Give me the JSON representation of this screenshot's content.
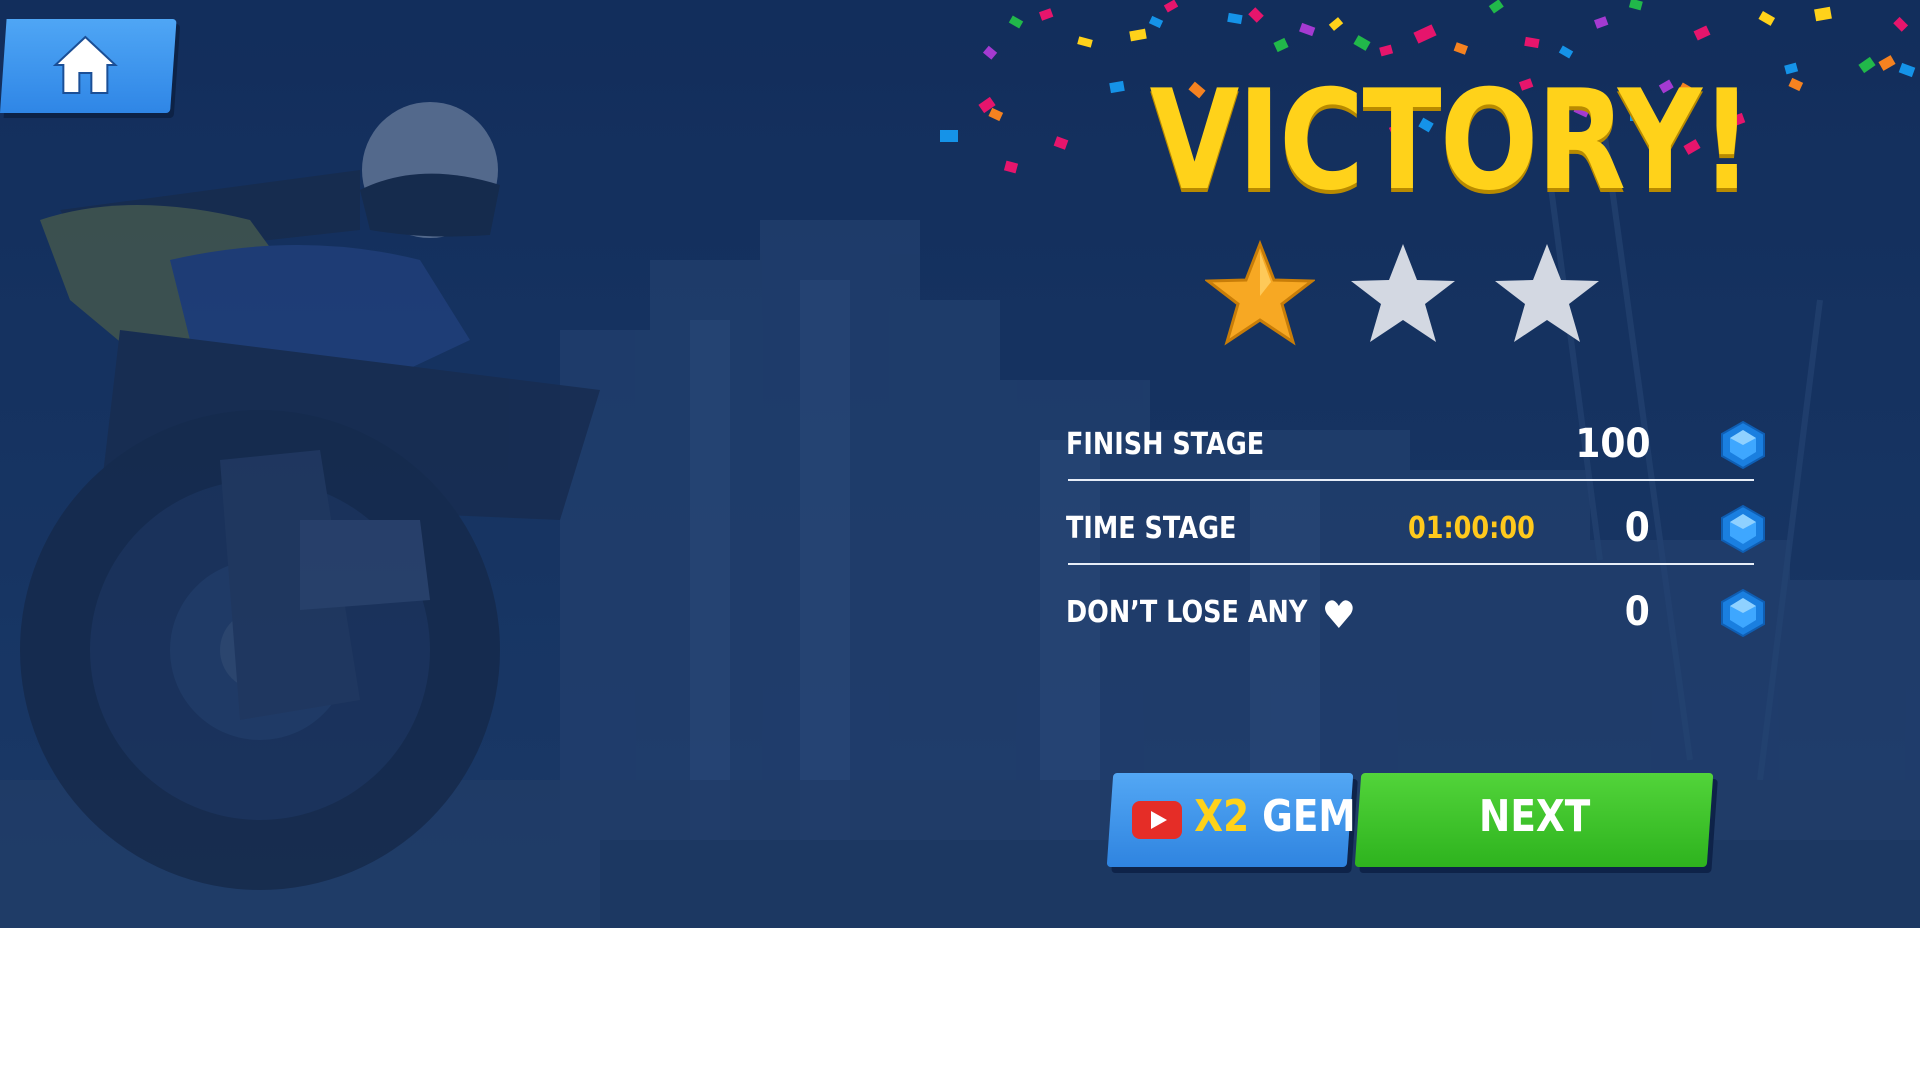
{
  "header": {
    "home_icon": "home-icon",
    "title": "VICTORY!"
  },
  "stars": {
    "earned": 1,
    "total": 3,
    "filled_color": "#f7a823",
    "empty_color": "#d3d8e2"
  },
  "rewards": [
    {
      "label": "FINISH STAGE",
      "extra": "",
      "value": "100",
      "icon": "gem-icon"
    },
    {
      "label": "TIME STAGE",
      "extra": "01:00:00",
      "value": "0",
      "icon": "gem-icon"
    },
    {
      "label": "DON’T LOSE ANY",
      "extra": "",
      "value": "0",
      "icon": "gem-icon",
      "label_icon": "heart-icon"
    }
  ],
  "buttons": {
    "x2_prefix": "X2",
    "x2_label": "GEM",
    "x2_icon": "video-play-icon",
    "next_label": "NEXT"
  },
  "colors": {
    "title": "#ffd21a",
    "time": "#ffc91c",
    "next_button": "#3cc52a",
    "x2_button": "#3d94ea",
    "background": "#1d3d70"
  }
}
